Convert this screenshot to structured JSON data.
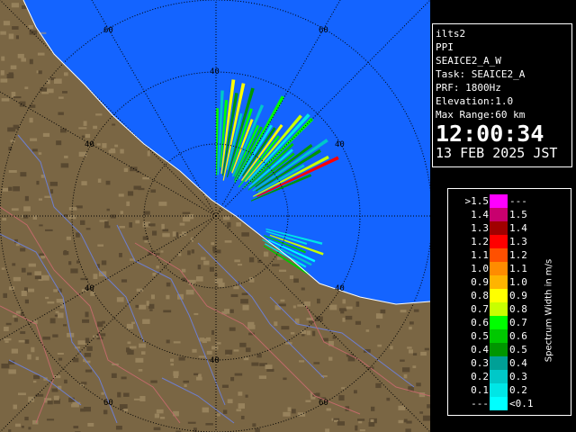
{
  "map": {
    "range_ring_labels": [
      "60",
      "60",
      "40",
      "40",
      "40",
      "40",
      "40",
      "60",
      "60"
    ]
  },
  "info": {
    "site": "ilts2",
    "mode": "PPI",
    "product": "SEAICE2_A_W",
    "task": "Task: SEAICE2_A",
    "prf": "PRF: 1800Hz",
    "elevation": "Elevation:1.0",
    "max_range": "Max Range:60 km",
    "time": "12:00:34",
    "date": "13 FEB 2025 JST"
  },
  "legend": {
    "unit_label": "Spectrum Width in m/s",
    "rows": [
      {
        "lo": ">1.5",
        "hi": "---",
        "color": "#ff00ff"
      },
      {
        "lo": "1.4",
        "hi": "1.5",
        "color": "#c8006e"
      },
      {
        "lo": "1.3",
        "hi": "1.4",
        "color": "#a00000"
      },
      {
        "lo": "1.2",
        "hi": "1.3",
        "color": "#ff0000"
      },
      {
        "lo": "1.1",
        "hi": "1.2",
        "color": "#ff5000"
      },
      {
        "lo": "1.0",
        "hi": "1.1",
        "color": "#ff8c00"
      },
      {
        "lo": "0.9",
        "hi": "1.0",
        "color": "#ffb400"
      },
      {
        "lo": "0.8",
        "hi": "0.9",
        "color": "#ffff00"
      },
      {
        "lo": "0.7",
        "hi": "0.8",
        "color": "#c8ff00"
      },
      {
        "lo": "0.6",
        "hi": "0.7",
        "color": "#00ff00"
      },
      {
        "lo": "0.5",
        "hi": "0.6",
        "color": "#00c800"
      },
      {
        "lo": "0.4",
        "hi": "0.5",
        "color": "#009600"
      },
      {
        "lo": "0.3",
        "hi": "0.4",
        "color": "#00a096"
      },
      {
        "lo": "0.2",
        "hi": "0.3",
        "color": "#00c8c8"
      },
      {
        "lo": "0.1",
        "hi": "0.2",
        "color": "#00e6e6"
      },
      {
        "lo": "---",
        "hi": "<0.1",
        "color": "#00ffff"
      }
    ]
  }
}
